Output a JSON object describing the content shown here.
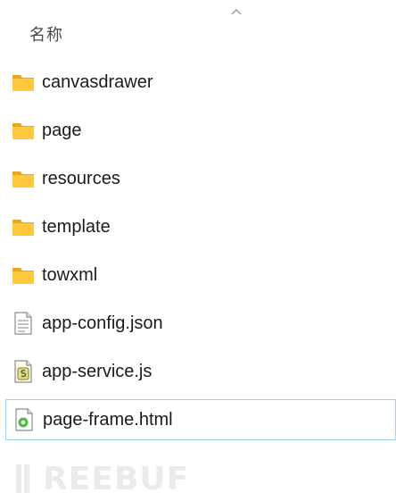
{
  "header": {
    "column_name": "名称",
    "sort_icon": "chevron-up-icon"
  },
  "files": [
    {
      "name": "canvasdrawer",
      "type": "folder",
      "icon": "folder-icon"
    },
    {
      "name": "page",
      "type": "folder",
      "icon": "folder-icon"
    },
    {
      "name": "resources",
      "type": "folder",
      "icon": "folder-icon"
    },
    {
      "name": "template",
      "type": "folder",
      "icon": "folder-icon"
    },
    {
      "name": "towxml",
      "type": "folder",
      "icon": "folder-icon"
    },
    {
      "name": "app-config.json",
      "type": "file",
      "icon": "text-file-icon"
    },
    {
      "name": "app-service.js",
      "type": "file",
      "icon": "script-file-icon"
    },
    {
      "name": "page-frame.html",
      "type": "file",
      "icon": "html-file-icon",
      "selected": true
    }
  ],
  "watermark": {
    "text": "REEBUF",
    "logo": "freebuf-logo"
  },
  "colors": {
    "folder": "#ffc83d",
    "folder_dark": "#e8a623",
    "selection_border": "#99d1ff",
    "watermark": "#e9ece9"
  }
}
